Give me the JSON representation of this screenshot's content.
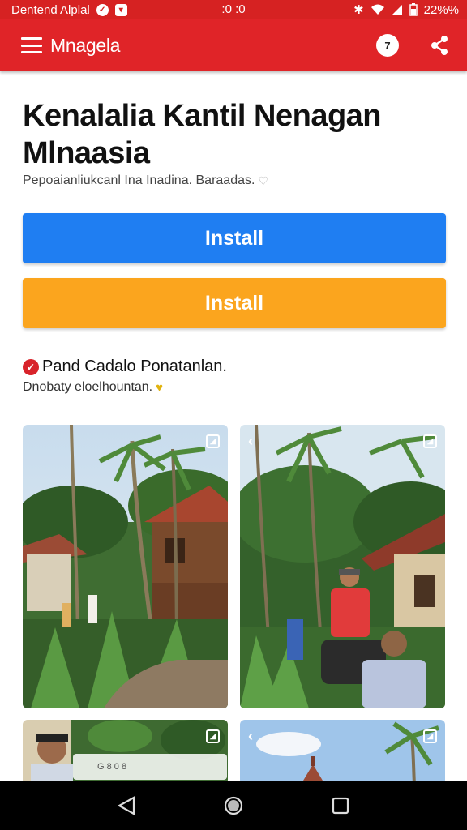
{
  "status_bar": {
    "left_text": "Dentend Alplal",
    "time": ":0 :0",
    "battery": "22%%",
    "icons": [
      "shield-icon",
      "mail-icon",
      "bluetooth-icon",
      "wifi-icon",
      "signal-icon",
      "battery-icon"
    ]
  },
  "app_bar": {
    "title": "Mnagela",
    "badge_count": "7",
    "menu_icon": "hamburger-icon",
    "share_icon": "share-icon",
    "color": "#e02428"
  },
  "header": {
    "title": "Kenalalia Kantil Nenagan Mlnaasia",
    "subtitle": "Pepoaianliukcanl Ina Inadina. Baraadas."
  },
  "buttons": {
    "install_primary": "Install",
    "install_secondary": "Install",
    "primary_color": "#1f7ef2",
    "secondary_color": "#fba51e"
  },
  "section": {
    "heading": "Pand Cadalo Ponatanlan.",
    "subheading": "Dnobaty eloelhountan."
  },
  "gallery": {
    "photos": [
      {
        "alt": "village-houses-palm-trees-photo"
      },
      {
        "alt": "people-on-motorbike-village-photo"
      },
      {
        "alt": "person-portrait-photo"
      },
      {
        "alt": "temple-roof-palm-photo"
      }
    ],
    "caption_text": "G̶ 8 0 8"
  },
  "nav": {
    "back_icon": "back-icon",
    "home_icon": "home-icon",
    "recents_icon": "recents-icon"
  }
}
